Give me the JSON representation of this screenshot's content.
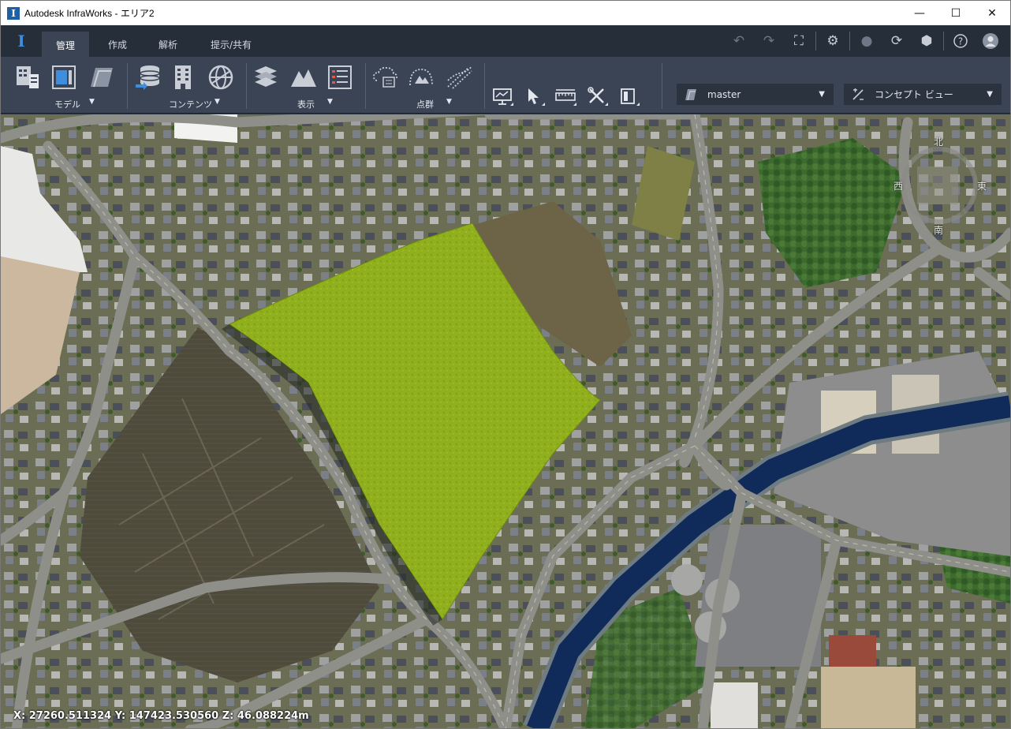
{
  "window": {
    "title": "Autodesk InfraWorks - エリア2",
    "app_icon_glyph": "I",
    "controls": {
      "minimize": "—",
      "maximize": "☐",
      "close": "✕"
    }
  },
  "tabs": {
    "logo_glyph": "I",
    "items": [
      {
        "label": "管理",
        "active": true
      },
      {
        "label": "作成",
        "active": false
      },
      {
        "label": "解析",
        "active": false
      },
      {
        "label": "提示/共有",
        "active": false
      }
    ]
  },
  "top_icons": [
    {
      "name": "undo-icon",
      "glyph": "↶",
      "dim": true
    },
    {
      "name": "redo-icon",
      "glyph": "↷",
      "dim": true
    },
    {
      "name": "fit-view-icon",
      "glyph": "⛶",
      "dim": false
    },
    {
      "name": "settings-icon",
      "glyph": "⚙",
      "dim": false
    },
    {
      "name": "globe-icon",
      "glyph": "●",
      "dim": true
    },
    {
      "name": "sync-icon",
      "glyph": "⟳",
      "dim": false
    },
    {
      "name": "model-cube-icon",
      "glyph": "⬢",
      "dim": false
    },
    {
      "name": "help-icon",
      "glyph": "?",
      "dim": false
    },
    {
      "name": "user-avatar-icon",
      "glyph": "●",
      "dim": false
    }
  ],
  "ribbon": {
    "groups": [
      {
        "label": "モデル",
        "arrow": "▼"
      },
      {
        "label": "コンテンツ",
        "arrow": "▼"
      },
      {
        "label": "表示",
        "arrow": "▼"
      },
      {
        "label": "点群",
        "arrow": "▼"
      }
    ],
    "version_dropdown": {
      "value": "master",
      "arrow": "▼"
    },
    "view_dropdown": {
      "value": "コンセプト ビュー",
      "arrow": "▼"
    }
  },
  "viewport": {
    "coordinates": "X: 27260.511324 Y: 147423.530560 Z: 46.088224m",
    "compass": {
      "north": "北",
      "south": "南",
      "east": "東",
      "west": "西"
    }
  },
  "colors": {
    "titlebar": "#ffffff",
    "tabbar": "#262e3a",
    "ribbon": "#3a4454",
    "accent": "#3e8edd",
    "terrain_highlight": "#8fb01c",
    "river": "#102a5a"
  }
}
